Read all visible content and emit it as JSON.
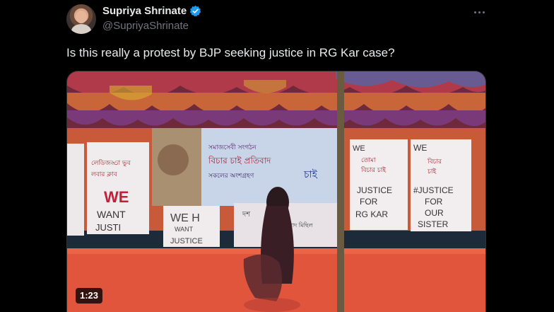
{
  "author": {
    "display_name": "Supriya Shrinate",
    "handle": "@SupriyaShrinate",
    "verified_color": "#1d9bf0"
  },
  "more_icon": "more-horizontal-icon",
  "tweet": {
    "text": "Is this really a protest by BJP seeking justice in RG Kar case?"
  },
  "video": {
    "duration": "1:23",
    "signs": {
      "left_top": "লেডিজড্ডা ভুব লবার লেডিজ ক্লাব",
      "we_want_justice_left": [
        "WE",
        "WANT",
        "JUSTI"
      ],
      "we_want_justice_center": [
        "WE",
        "WANT",
        "JUSTICE"
      ],
      "justice_for_rg_kar": [
        "JUSTICE",
        "FOR",
        "RG KAR"
      ],
      "justice_for_our_sister": [
        "#JUSTICE",
        "FOR",
        "OUR",
        "SISTER"
      ],
      "we_top_right": "WE"
    }
  }
}
